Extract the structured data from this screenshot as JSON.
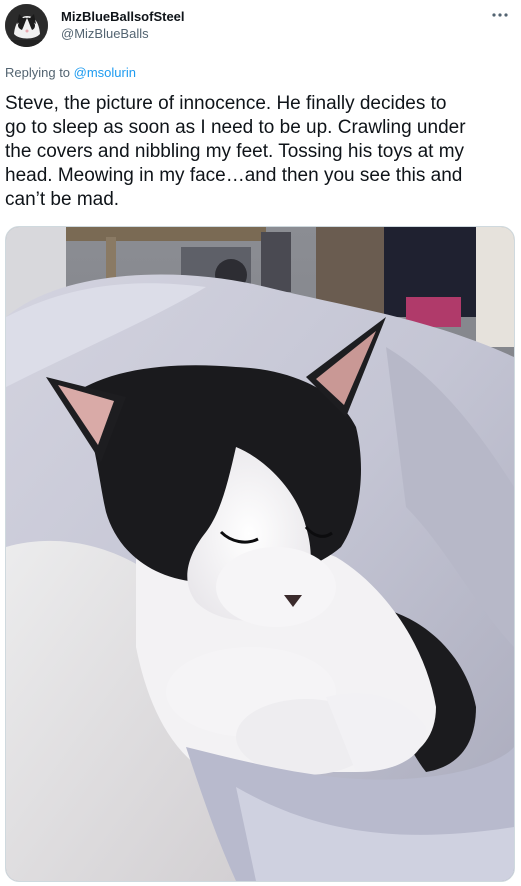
{
  "tweet": {
    "author": {
      "display_name": "MizBlueBallsofSteel",
      "handle": "@MizBlueBalls",
      "avatar_icon": "avatar-cat-icon"
    },
    "more_icon": "more-horizontal-icon",
    "reply_context": {
      "prefix": "Replying to ",
      "mention": "@msolurin"
    },
    "text": "Steve, the picture of innocence. He finally decides to\ngo to sleep as soon as I need to be up. Crawling under\nthe covers and nibbling my feet. Tossing his toys at my\nhead. Meowing in my face…and then you see this and\ncan’t be mad.",
    "media": {
      "type": "photo"
    }
  },
  "colors": {
    "text_primary": "#0f1419",
    "text_secondary": "#536471",
    "link": "#1d9bf0",
    "border": "#cfd9de"
  }
}
